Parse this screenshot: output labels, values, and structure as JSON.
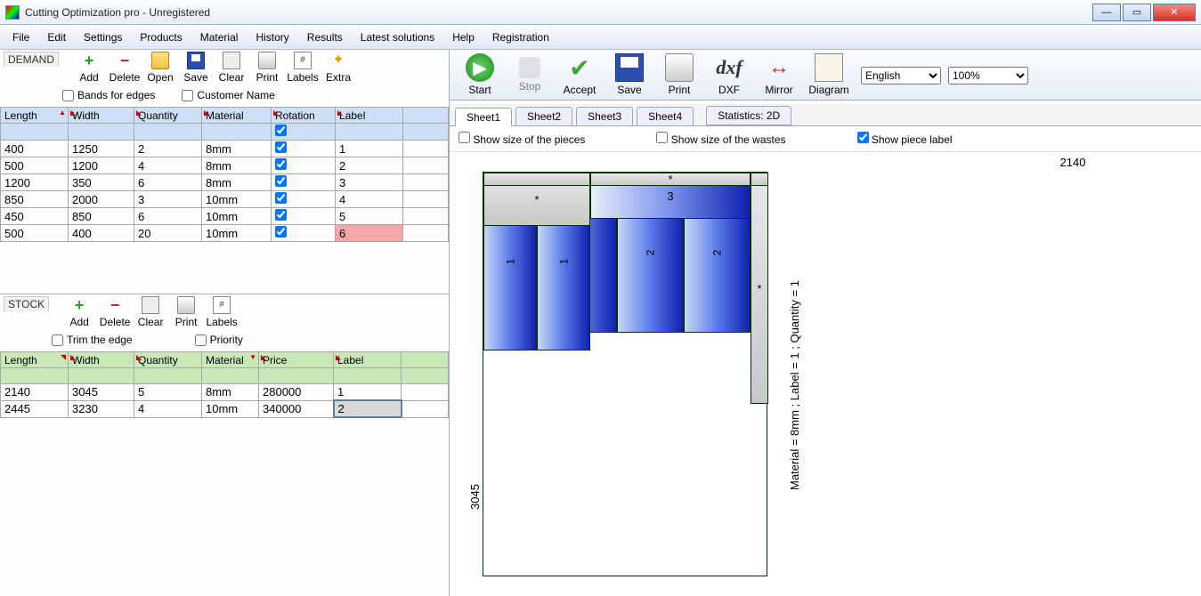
{
  "window": {
    "title": "Cutting Optimization pro - Unregistered"
  },
  "menu": [
    "File",
    "Edit",
    "Settings",
    "Products",
    "Material",
    "History",
    "Results",
    "Latest solutions",
    "Help",
    "Registration"
  ],
  "demand": {
    "label": "DEMAND",
    "buttons": {
      "add": "Add",
      "delete": "Delete",
      "open": "Open",
      "save": "Save",
      "clear": "Clear",
      "print": "Print",
      "labels": "Labels",
      "extra": "Extra"
    },
    "opts": {
      "bands": "Bands for edges",
      "cust": "Customer Name"
    },
    "cols": [
      "Length",
      "Width",
      "Quantity",
      "Material",
      "Rotation",
      "Label"
    ],
    "rows": [
      {
        "length": "400",
        "width": "1250",
        "qty": "2",
        "mat": "8mm",
        "rot": true,
        "label": "1",
        "hl": false
      },
      {
        "length": "500",
        "width": "1200",
        "qty": "4",
        "mat": "8mm",
        "rot": true,
        "label": "2",
        "hl": false
      },
      {
        "length": "1200",
        "width": "350",
        "qty": "6",
        "mat": "8mm",
        "rot": true,
        "label": "3",
        "hl": false
      },
      {
        "length": "850",
        "width": "2000",
        "qty": "3",
        "mat": "10mm",
        "rot": true,
        "label": "4",
        "hl": false
      },
      {
        "length": "450",
        "width": "850",
        "qty": "6",
        "mat": "10mm",
        "rot": true,
        "label": "5",
        "hl": false
      },
      {
        "length": "500",
        "width": "400",
        "qty": "20",
        "mat": "10mm",
        "rot": true,
        "label": "6",
        "hl": true
      }
    ]
  },
  "stock": {
    "label": "STOCK",
    "buttons": {
      "add": "Add",
      "delete": "Delete",
      "clear": "Clear",
      "print": "Print",
      "labels": "Labels"
    },
    "opts": {
      "trim": "Trim the edge",
      "prio": "Priority"
    },
    "cols": [
      "Length",
      "Width",
      "Quantity",
      "Material",
      "Price",
      "Label"
    ],
    "rows": [
      {
        "length": "2140",
        "width": "3045",
        "qty": "5",
        "mat": "8mm",
        "price": "280000",
        "label": "1",
        "sel": false
      },
      {
        "length": "2445",
        "width": "3230",
        "qty": "4",
        "mat": "10mm",
        "price": "340000",
        "label": "2",
        "sel": true
      }
    ]
  },
  "rtool": {
    "start": "Start",
    "stop": "Stop",
    "accept": "Accept",
    "save": "Save",
    "print": "Print",
    "dxf": "DXF",
    "mirror": "Mirror",
    "diagram": "Diagram",
    "lang": "English",
    "zoom": "100%"
  },
  "tabs": [
    "Sheet1",
    "Sheet2",
    "Sheet3",
    "Sheet4"
  ],
  "stats": "Statistics: 2D",
  "viewopts": {
    "pieces": "Show size of the pieces",
    "wastes": "Show size of the wastes",
    "label": "Show piece label"
  },
  "sheet": {
    "w": "2140",
    "h": "3045",
    "info": "Material = 8mm ; Label = 1 ; Quantity = 1"
  }
}
